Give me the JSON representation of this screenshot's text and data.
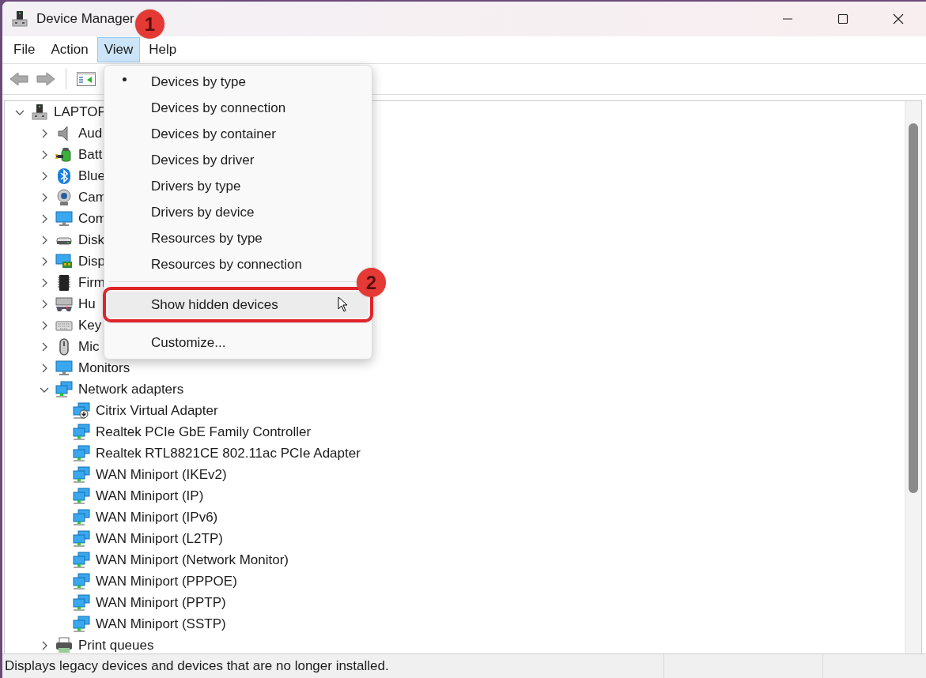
{
  "window": {
    "title": "Device Manager"
  },
  "menu_bar": [
    {
      "label": "File",
      "selected": false
    },
    {
      "label": "Action",
      "selected": false
    },
    {
      "label": "View",
      "selected": true
    },
    {
      "label": "Help",
      "selected": false
    }
  ],
  "tree": {
    "label": "LAPTOP",
    "expanded": true,
    "children": [
      {
        "label": "Aud",
        "expanded": false
      },
      {
        "label": "Batt",
        "expanded": false
      },
      {
        "label": "Blue",
        "expanded": false
      },
      {
        "label": "Cam",
        "expanded": false
      },
      {
        "label": "Com",
        "expanded": false
      },
      {
        "label": "Disk",
        "expanded": false
      },
      {
        "label": "Disp",
        "expanded": false
      },
      {
        "label": "Firm",
        "expanded": false
      },
      {
        "label": "Hu",
        "expanded": false
      },
      {
        "label": "Key",
        "expanded": false
      },
      {
        "label": "Mic",
        "expanded": false
      },
      {
        "label": "Monitors",
        "expanded": false
      },
      {
        "label": "Network adapters",
        "expanded": true,
        "children": [
          {
            "label": "Citrix Virtual Adapter"
          },
          {
            "label": "Realtek PCIe GbE Family Controller"
          },
          {
            "label": "Realtek RTL8821CE 802.11ac PCIe Adapter"
          },
          {
            "label": "WAN Miniport (IKEv2)"
          },
          {
            "label": "WAN Miniport (IP)"
          },
          {
            "label": "WAN Miniport (IPv6)"
          },
          {
            "label": "WAN Miniport (L2TP)"
          },
          {
            "label": "WAN Miniport (Network Monitor)"
          },
          {
            "label": "WAN Miniport (PPPOE)"
          },
          {
            "label": "WAN Miniport (PPTP)"
          },
          {
            "label": "WAN Miniport (SSTP)"
          }
        ]
      },
      {
        "label": "Print queues",
        "expanded": false
      }
    ]
  },
  "view_menu": {
    "items": [
      {
        "kind": "item",
        "label": "Devices by type",
        "checked": true,
        "highlighted": false,
        "marked": false
      },
      {
        "kind": "item",
        "label": "Devices by connection",
        "checked": false,
        "highlighted": false,
        "marked": false
      },
      {
        "kind": "item",
        "label": "Devices by container",
        "checked": false,
        "highlighted": false,
        "marked": false
      },
      {
        "kind": "item",
        "label": "Devices by driver",
        "checked": false,
        "highlighted": false,
        "marked": false
      },
      {
        "kind": "item",
        "label": "Drivers by type",
        "checked": false,
        "highlighted": false,
        "marked": false
      },
      {
        "kind": "item",
        "label": "Drivers by device",
        "checked": false,
        "highlighted": false,
        "marked": false
      },
      {
        "kind": "item",
        "label": "Resources by type",
        "checked": false,
        "highlighted": false,
        "marked": false
      },
      {
        "kind": "item",
        "label": "Resources by connection",
        "checked": false,
        "highlighted": false,
        "marked": false
      },
      {
        "kind": "separator"
      },
      {
        "kind": "item",
        "label": "Show hidden devices",
        "checked": false,
        "highlighted": true,
        "marked": true
      },
      {
        "kind": "separator"
      },
      {
        "kind": "item",
        "label": "Customize...",
        "checked": false,
        "highlighted": false,
        "marked": false
      }
    ]
  },
  "annotations": [
    {
      "label": "1"
    },
    {
      "label": "2"
    }
  ],
  "status_bar": {
    "text": "Displays legacy devices and devices that are no longer installed."
  }
}
